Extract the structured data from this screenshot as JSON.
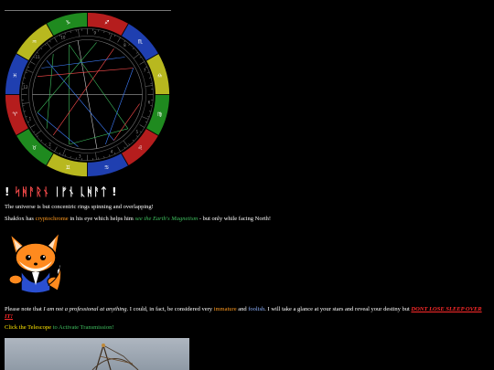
{
  "title": {
    "prefix": "! ",
    "words": [
      "ᛋᚻᚨᚱᚾ",
      "ᛁᚠᚾ",
      "ᚳᚻᚨᛏ"
    ],
    "suffix": " !"
  },
  "intro": "The universe is but concentric rings spinning and overlapping!",
  "shakfox": {
    "before": "Shakfox has ",
    "cryptochrome": "cryptochrome",
    "middle": " in his eye which helps him ",
    "magnetism": "see the Earth's Magnetism",
    "after": " - but only while facing North!"
  },
  "disclaimer": {
    "a": "Please note that ",
    "b": "I am not a professional at anything",
    "c": ". I could, in fact, be considered very ",
    "immature": "immature",
    "d": " and ",
    "foolish": "foolish",
    "e": ". I will take a glance at your stars and reveal your destiny but ",
    "warning": "DONT LOSE SLEEP OVER IT!"
  },
  "telescope": {
    "link": "Click the Telescope",
    "rest": " to Activate Transmission!"
  },
  "zodiac_glyphs": [
    "♈",
    "♉",
    "♊",
    "♋",
    "♌",
    "♍",
    "♎",
    "♏",
    "♐",
    "♑",
    "♒",
    "♓"
  ],
  "colors": {
    "fire": "#b51d1d",
    "earth": "#1f8a1f",
    "air": "#b8b81f",
    "water": "#1f3fb0",
    "accent_red": "#ff2a2a",
    "accent_orange": "#ff9a1f",
    "accent_green": "#3fbf5f"
  },
  "icons": {
    "mascot": "fox-mascot-icon",
    "telescope": "telescope-photo"
  }
}
